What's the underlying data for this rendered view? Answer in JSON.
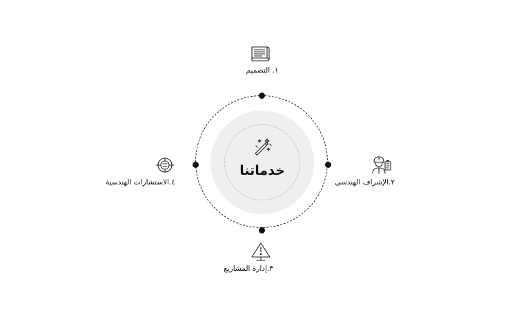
{
  "center": {
    "title": "خدماتنا",
    "icon": "magic-wand-icon"
  },
  "services": [
    {
      "label": "١. التصميم",
      "icon": "blueprint-icon"
    },
    {
      "label": "٢.الإشراف الهندسي",
      "icon": "engineer-icon"
    },
    {
      "label": "٣.إدارة المشاريع",
      "icon": "warning-sign-icon"
    },
    {
      "label": "٤.الاستشارات الهندسية",
      "icon": "consultation-icon"
    }
  ],
  "colors": {
    "background": "#ffffff",
    "core_fill": "#efefef",
    "ink": "#111111"
  }
}
